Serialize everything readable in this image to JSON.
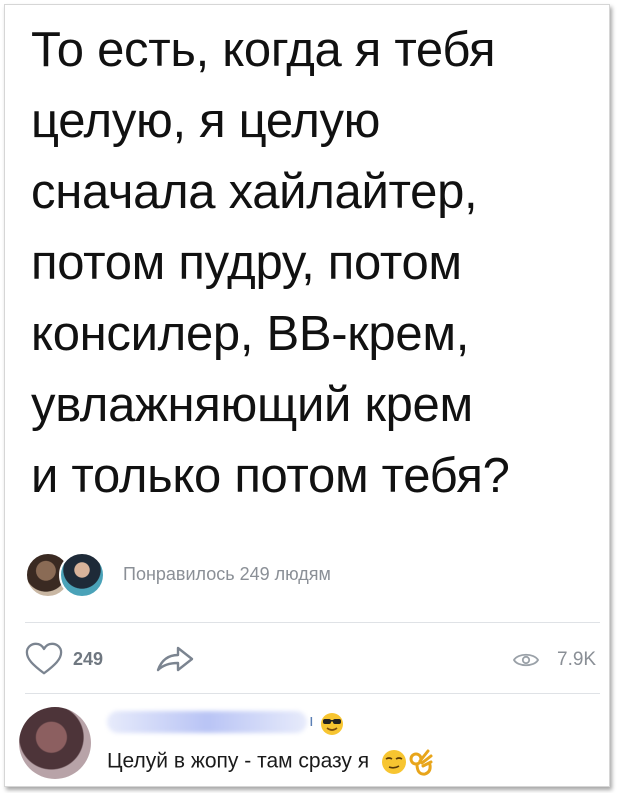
{
  "post": {
    "text_lines": [
      "То есть, когда я тебя",
      "целую, я целую",
      "сначала хайлайтер,",
      "потом пудру, потом",
      "консилер, BB-крем,",
      "увлажняющий крем",
      "и только потом тебя?"
    ]
  },
  "likes_summary": {
    "text": "Понравилось 249 людям"
  },
  "actions": {
    "like_count": "249",
    "views": "7.9K"
  },
  "comment": {
    "author_suffix": "ı",
    "text": "Целуй в жопу - там сразу я",
    "emojis": [
      "cool-sunglasses-emoji",
      "relieved-face-emoji",
      "ok-hand-emoji"
    ]
  },
  "colors": {
    "accent": "#5b7fb5",
    "muted": "#8a8f96",
    "divider": "#dfe2e6"
  }
}
